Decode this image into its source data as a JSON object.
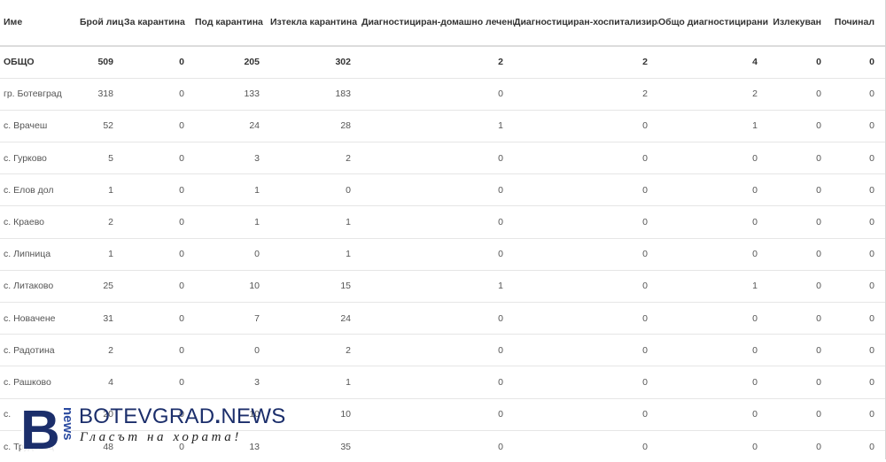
{
  "table": {
    "headers": [
      "Име",
      "Брой лица",
      "За карантина",
      "Под карантина",
      "Изтекла карантина",
      "Диагностициран-домашно лечение",
      "Диагностициран-хоспитализиран",
      "Общо диагностицирани",
      "Излекуван",
      "Починал"
    ],
    "rows": [
      [
        "ОБЩО",
        "509",
        "0",
        "205",
        "302",
        "2",
        "2",
        "4",
        "0",
        "0"
      ],
      [
        "гр. Ботевград",
        "318",
        "0",
        "133",
        "183",
        "0",
        "2",
        "2",
        "0",
        "0"
      ],
      [
        "с. Врачеш",
        "52",
        "0",
        "24",
        "28",
        "1",
        "0",
        "1",
        "0",
        "0"
      ],
      [
        "с. Гурково",
        "5",
        "0",
        "3",
        "2",
        "0",
        "0",
        "0",
        "0",
        "0"
      ],
      [
        "с. Елов дол",
        "1",
        "0",
        "1",
        "0",
        "0",
        "0",
        "0",
        "0",
        "0"
      ],
      [
        "с. Краево",
        "2",
        "0",
        "1",
        "1",
        "0",
        "0",
        "0",
        "0",
        "0"
      ],
      [
        "с. Липница",
        "1",
        "0",
        "0",
        "1",
        "0",
        "0",
        "0",
        "0",
        "0"
      ],
      [
        "с. Литаково",
        "25",
        "0",
        "10",
        "15",
        "1",
        "0",
        "1",
        "0",
        "0"
      ],
      [
        "с. Новачене",
        "31",
        "0",
        "7",
        "24",
        "0",
        "0",
        "0",
        "0",
        "0"
      ],
      [
        "с. Радотина",
        "2",
        "0",
        "0",
        "2",
        "0",
        "0",
        "0",
        "0",
        "0"
      ],
      [
        "с. Рашково",
        "4",
        "0",
        "3",
        "1",
        "0",
        "0",
        "0",
        "0",
        "0"
      ],
      [
        "с.",
        "20",
        "0",
        "10",
        "10",
        "0",
        "0",
        "0",
        "0",
        "0"
      ],
      [
        "с. Трудовец",
        "48",
        "0",
        "13",
        "35",
        "0",
        "0",
        "0",
        "0",
        "0"
      ]
    ]
  },
  "watermark": {
    "brand_prefix": "BOTEVGRAD",
    "brand_dot": ".",
    "brand_suffix": "NEWS",
    "slogan": "Гласът на хората!",
    "logo_letter": "B",
    "logo_vertical": "news",
    "colors": {
      "primary": "#1b2e6b",
      "accent": "#2a4aa0"
    }
  }
}
